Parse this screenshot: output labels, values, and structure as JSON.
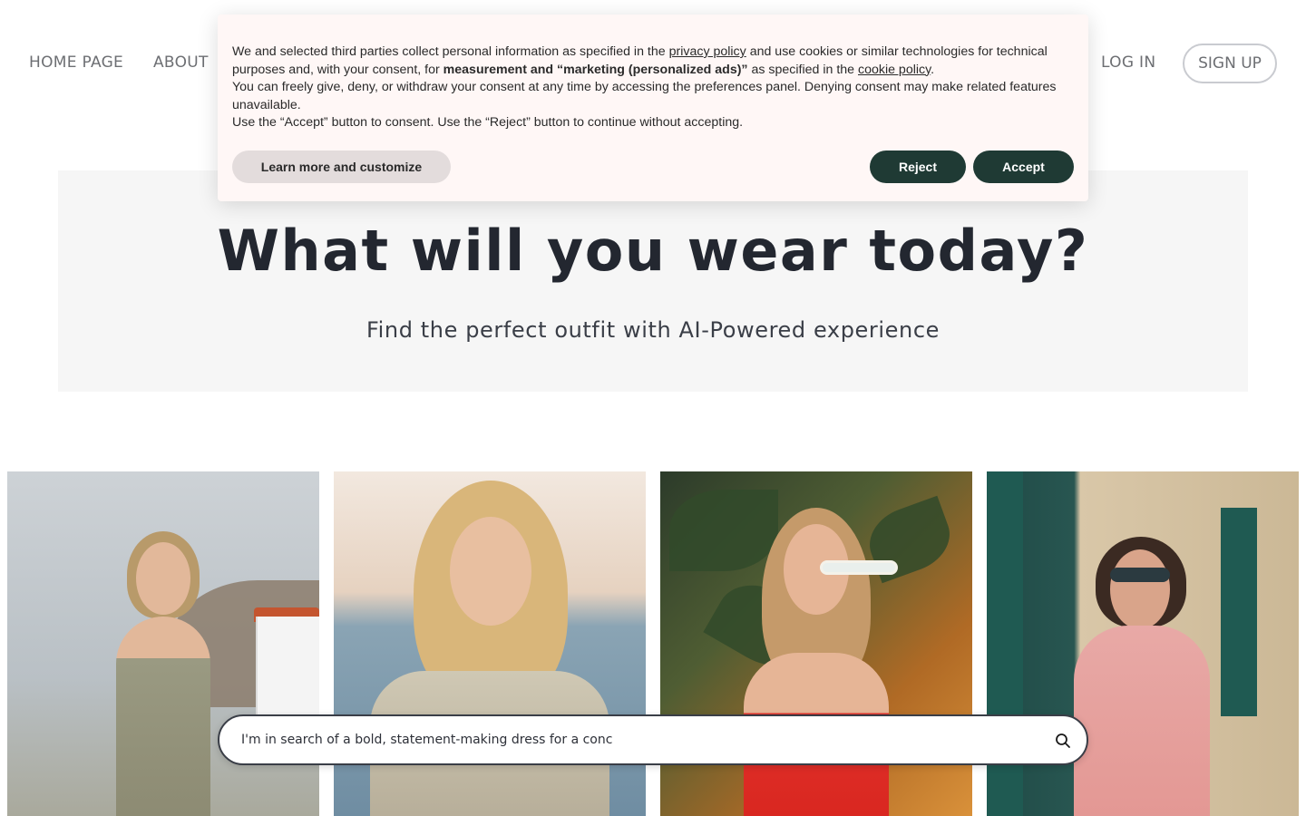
{
  "nav": {
    "home": "HOME PAGE",
    "about": "ABOUT",
    "login": "LOG IN",
    "signup": "SIGN UP"
  },
  "hero": {
    "title": "What will you wear today?",
    "subtitle": "Find the perfect outfit with AI-Powered experience"
  },
  "gallery": {
    "items": [
      "dress-photo-1",
      "dress-photo-2",
      "dress-photo-3",
      "dress-photo-4"
    ]
  },
  "search": {
    "placeholder": "I'm in search of a bold, statement-making dress for a conc",
    "icon": "search-icon"
  },
  "cookie": {
    "text_1": "We and selected third parties collect personal information as specified in the ",
    "privacy_link": "privacy policy",
    "text_2": " and use cookies or similar technologies for technical purposes and, with your consent, for ",
    "bold": "measurement and “marketing (personalized ads)”",
    "text_3": " as specified in the ",
    "cookie_link": "cookie policy",
    "text_4": ".",
    "line_2": "You can freely give, deny, or withdraw your consent at any time by accessing the preferences panel. Denying consent may make related features unavailable.",
    "line_3": "Use the “Accept” button to consent. Use the “Reject” button to continue without accepting.",
    "learn_label": "Learn more and customize",
    "reject_label": "Reject",
    "accept_label": "Accept"
  },
  "colors": {
    "dark_green": "#1f3a34",
    "banner_bg": "#fff7f6",
    "hero_bg": "#f6f6f6",
    "text_dark": "#232730",
    "nav_gray": "#6d6f73"
  }
}
